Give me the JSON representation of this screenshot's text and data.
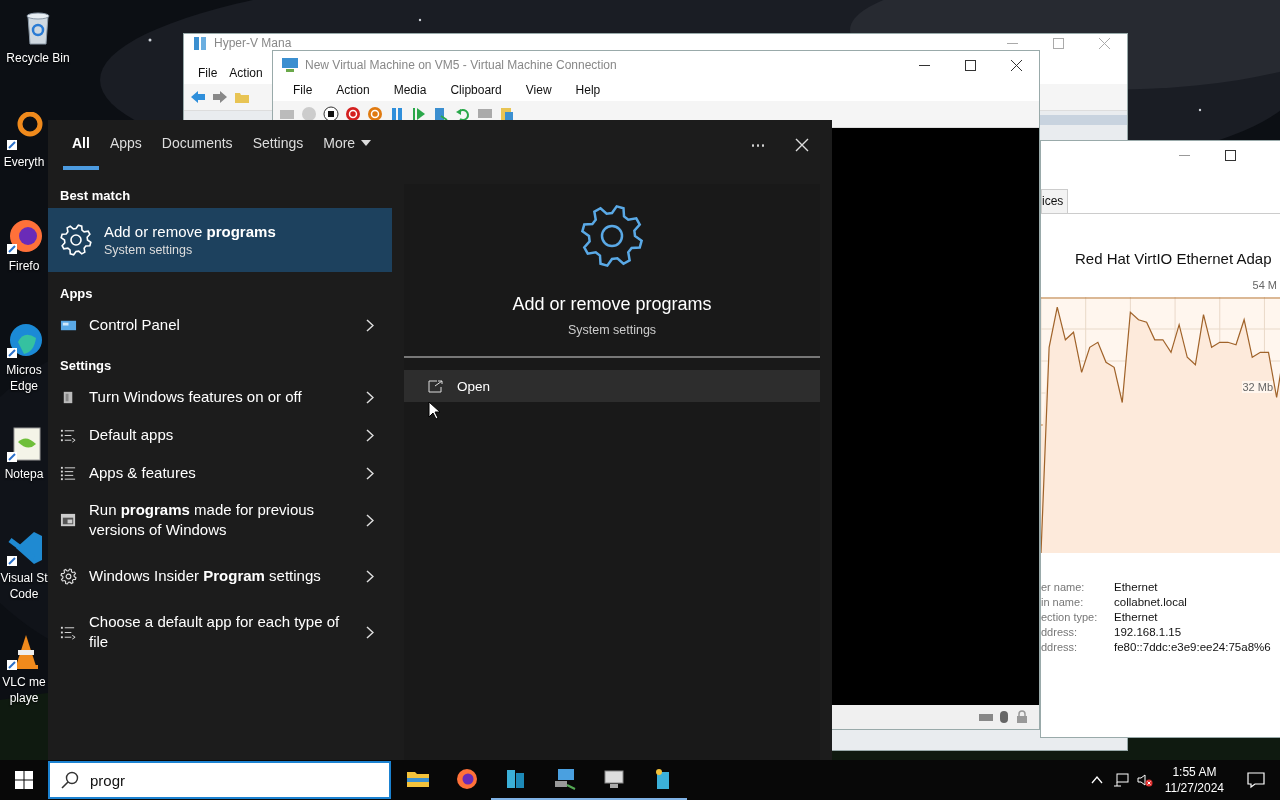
{
  "desktop": {
    "icons": [
      {
        "lines": [
          "Recycle Bin"
        ],
        "kind": "recycle-bin"
      },
      {
        "lines": [
          "Everyth"
        ],
        "kind": "search-app"
      },
      {
        "lines": [
          "Firefo"
        ],
        "kind": "firefox"
      },
      {
        "lines": [
          "Micros",
          "Edge"
        ],
        "kind": "edge"
      },
      {
        "lines": [
          "Notepa"
        ],
        "kind": "notepad"
      },
      {
        "lines": [
          "Visual St",
          "Code"
        ],
        "kind": "vscode"
      },
      {
        "lines": [
          "VLC me",
          "playe"
        ],
        "kind": "vlc"
      }
    ]
  },
  "hyperv_manager": {
    "title": "Hyper-V Mana",
    "menu": [
      "File",
      "Action"
    ]
  },
  "vm_connection": {
    "title": "New Virtual Machine on VM5 - Virtual Machine Connection",
    "menu": [
      "File",
      "Action",
      "Media",
      "Clipboard",
      "View",
      "Help"
    ]
  },
  "network_window": {
    "tab": "ices",
    "adapter_title": "Red Hat VirtIO Ethernet Adap",
    "scale_top": "54 M",
    "scale_mid": "32 Mb",
    "details": [
      {
        "label": "er name:",
        "value": "Ethernet"
      },
      {
        "label": "in name:",
        "value": "collabnet.local"
      },
      {
        "label": "ection type:",
        "value": "Ethernet"
      },
      {
        "label": "ddress:",
        "value": "192.168.1.15"
      },
      {
        "label": "ddress:",
        "value": "fe80::7ddc:e3e9:ee24:75a8%6"
      }
    ]
  },
  "search_panel": {
    "tabs": [
      {
        "label": "All",
        "selected": true,
        "kind": "tab"
      },
      {
        "label": "Apps",
        "selected": false,
        "kind": "tab"
      },
      {
        "label": "Documents",
        "selected": false,
        "kind": "tab"
      },
      {
        "label": "Settings",
        "selected": false,
        "kind": "tab"
      },
      {
        "label": "More",
        "selected": false,
        "kind": "dropdown"
      }
    ],
    "best_match": {
      "heading": "Best match",
      "title": "Add or remove **programs**",
      "subtitle": "System settings",
      "selected": true
    },
    "groups": [
      {
        "heading": "Apps",
        "items": [
          {
            "label": "Control Panel",
            "kind": "control-panel"
          }
        ]
      },
      {
        "heading": "Settings",
        "items": [
          {
            "label": "Turn Windows features on or off",
            "kind": "features"
          },
          {
            "label": "Default apps",
            "kind": "list-arrow"
          },
          {
            "label": "Apps & features",
            "kind": "list"
          },
          {
            "label": "Run **programs** made for previous versions of Windows",
            "kind": "window"
          },
          {
            "label": "Windows Insider **Program** settings",
            "kind": "gear"
          },
          {
            "label": "Choose a default app for each type of file",
            "kind": "list-arrow"
          }
        ]
      }
    ],
    "detail": {
      "title": "Add or remove programs",
      "subtitle": "System settings",
      "actions": [
        {
          "label": "Open",
          "hovered": true
        }
      ]
    }
  },
  "taskbar": {
    "search": {
      "value": "progr"
    },
    "apps": [
      {
        "kind": "explorer",
        "running": false
      },
      {
        "kind": "firefox",
        "running": false
      },
      {
        "kind": "server",
        "running": true
      },
      {
        "kind": "network-pc",
        "running": true
      },
      {
        "kind": "vm-connect",
        "running": true
      },
      {
        "kind": "server-star",
        "running": true
      }
    ],
    "clock": {
      "time": "1:55 AM",
      "date": "11/27/2024"
    }
  }
}
